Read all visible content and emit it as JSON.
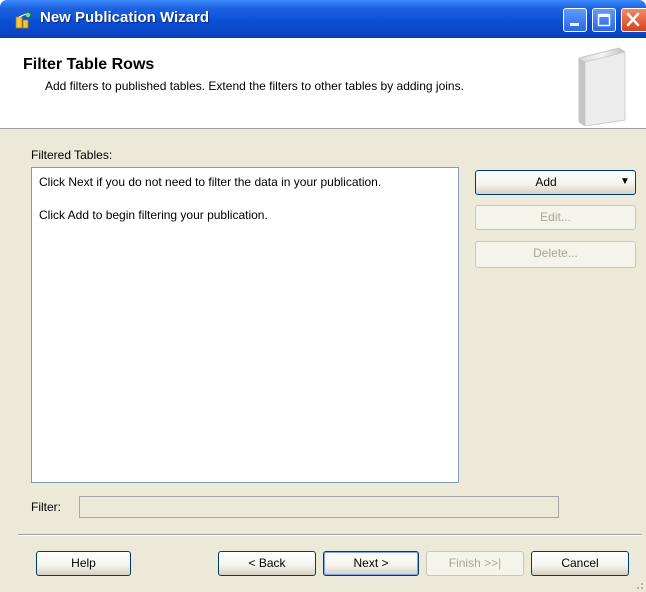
{
  "window": {
    "title": "New Publication Wizard"
  },
  "header": {
    "title": "Filter Table Rows",
    "subtitle": "Add filters to published tables. Extend the filters to other tables by adding joins."
  },
  "filtered_tables": {
    "label": "Filtered Tables:",
    "lines": [
      "Click Next if you do not need to filter the data in your publication.",
      "Click Add to begin filtering your publication."
    ]
  },
  "side_buttons": {
    "add": "Add",
    "add_arrow": "▼",
    "edit": "Edit...",
    "delete": "Delete..."
  },
  "filter": {
    "label": "Filter:",
    "value": ""
  },
  "footer": {
    "help": "Help",
    "back": "< Back",
    "next": "Next >",
    "finish": "Finish >>|",
    "cancel": "Cancel"
  },
  "colors": {
    "titlebar": "#0a46c4",
    "dialog_bg": "#ece9d8",
    "close_button": "#d4441c"
  }
}
